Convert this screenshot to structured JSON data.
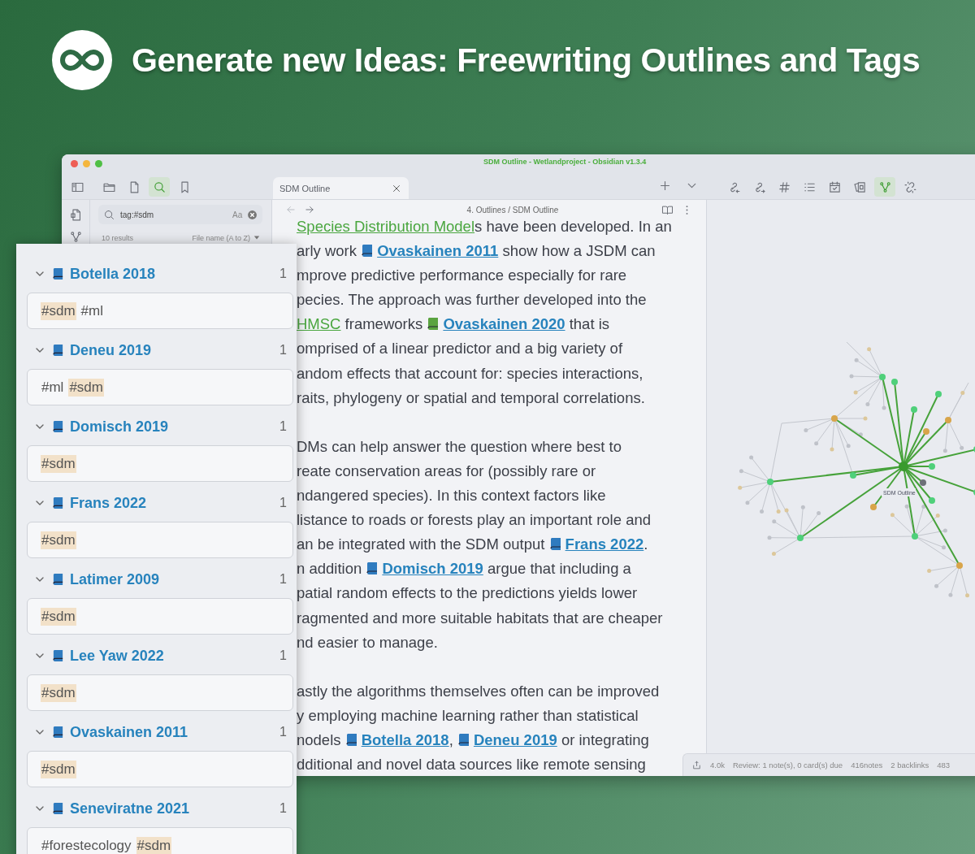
{
  "header": {
    "title": "Generate new Ideas: Freewriting Outlines and Tags"
  },
  "window": {
    "title": "SDM Outline - Wetlandproject - Obsidian v1.3.4"
  },
  "toolbar_left": [
    {
      "kind": "sidebar",
      "selected": false
    },
    {
      "kind": "folder",
      "selected": false
    },
    {
      "kind": "file",
      "selected": false
    },
    {
      "kind": "search",
      "selected": true
    },
    {
      "kind": "bookmark",
      "selected": false
    }
  ],
  "tab": {
    "label": "SDM Outline",
    "selected": true
  },
  "toolbar_right": [
    {
      "kind": "link-in",
      "selected": false
    },
    {
      "kind": "link-out",
      "selected": false
    },
    {
      "kind": "hash",
      "selected": false
    },
    {
      "kind": "list",
      "selected": false
    },
    {
      "kind": "calendar",
      "selected": false
    },
    {
      "kind": "cards",
      "selected": false
    },
    {
      "kind": "graph",
      "selected": true
    },
    {
      "kind": "unlink",
      "selected": false
    }
  ],
  "search": {
    "value": "tag:#sdm",
    "case_label": "Aa",
    "results": "10 results",
    "sort": "File name (A to Z)"
  },
  "breadcrumb": "4. Outlines / SDM Outline",
  "paragraphs": [
    {
      "lines": [
        {
          "segments": [
            {
              "kind": "wikilink",
              "text": "Species Distribution Model"
            },
            {
              "kind": "text",
              "text": "s have been developed. In an"
            }
          ]
        },
        {
          "segments": [
            {
              "kind": "text",
              "text": "arly work "
            },
            {
              "kind": "book",
              "color": "#2f7bbf"
            },
            {
              "kind": "link",
              "text": "Ovaskainen 2011"
            },
            {
              "kind": "text",
              "text": " show how a JSDM can"
            }
          ]
        },
        {
          "segments": [
            {
              "kind": "text",
              "text": "mprove predictive performance especially for rare"
            }
          ]
        },
        {
          "segments": [
            {
              "kind": "text",
              "text": "pecies. The approach was further developed into the"
            }
          ]
        },
        {
          "segments": [
            {
              "kind": "wikilink",
              "text": "HMSC"
            },
            {
              "kind": "text",
              "text": " frameworks "
            },
            {
              "kind": "book",
              "color": "#5aa33f"
            },
            {
              "kind": "link",
              "text": "Ovaskainen 2020"
            },
            {
              "kind": "text",
              "text": " that is"
            }
          ]
        },
        {
          "segments": [
            {
              "kind": "text",
              "text": "omprised of a linear predictor and a big variety of"
            }
          ]
        },
        {
          "segments": [
            {
              "kind": "text",
              "text": "andom effects that account for: species interactions,"
            }
          ]
        },
        {
          "segments": [
            {
              "kind": "text",
              "text": "raits, phylogeny or spatial and temporal correlations."
            }
          ]
        }
      ]
    },
    {
      "lines": [
        {
          "segments": [
            {
              "kind": "text",
              "text": "DMs can help answer the question where best to"
            }
          ]
        },
        {
          "segments": [
            {
              "kind": "text",
              "text": "reate conservation areas for (possibly rare or"
            }
          ]
        },
        {
          "segments": [
            {
              "kind": "text",
              "text": "ndangered species). In this context factors like"
            }
          ]
        },
        {
          "segments": [
            {
              "kind": "text",
              "text": "listance to roads or forests play an important role and"
            }
          ]
        },
        {
          "segments": [
            {
              "kind": "text",
              "text": "an be integrated with the SDM output "
            },
            {
              "kind": "book",
              "color": "#2f7bbf"
            },
            {
              "kind": "link",
              "text": "Frans 2022"
            },
            {
              "kind": "text",
              "text": "."
            }
          ]
        },
        {
          "segments": [
            {
              "kind": "text",
              "text": "n addition "
            },
            {
              "kind": "book",
              "color": "#2f7bbf"
            },
            {
              "kind": "link",
              "text": "Domisch 2019"
            },
            {
              "kind": "text",
              "text": " argue that including a"
            }
          ]
        },
        {
          "segments": [
            {
              "kind": "text",
              "text": "patial random effects to the predictions yields lower"
            }
          ]
        },
        {
          "segments": [
            {
              "kind": "text",
              "text": "ragmented and more suitable habitats that are cheaper"
            }
          ]
        },
        {
          "segments": [
            {
              "kind": "text",
              "text": "nd easier to manage."
            }
          ]
        }
      ]
    },
    {
      "lines": [
        {
          "segments": [
            {
              "kind": "text",
              "text": "astly the algorithms themselves often can be improved"
            }
          ]
        },
        {
          "segments": [
            {
              "kind": "text",
              "text": "y employing machine learning rather than statistical"
            }
          ]
        },
        {
          "segments": [
            {
              "kind": "text",
              "text": "nodels "
            },
            {
              "kind": "book",
              "color": "#2f7bbf"
            },
            {
              "kind": "link",
              "text": "Botella 2018"
            },
            {
              "kind": "text",
              "text": ", "
            },
            {
              "kind": "book",
              "color": "#2f7bbf"
            },
            {
              "kind": "link",
              "text": "Deneu 2019"
            },
            {
              "kind": "text",
              "text": " or integrating"
            }
          ]
        },
        {
          "segments": [
            {
              "kind": "text",
              "text": "dditional and novel data sources like remote sensing"
            }
          ]
        }
      ]
    }
  ],
  "graph": {
    "center_label": "SDM Outline"
  },
  "status_bar": [
    "4.0k",
    "Review: 1 note(s), 0 card(s) due",
    "416notes",
    "2 backlinks",
    "483"
  ],
  "results": [
    {
      "title": "Botella 2018",
      "count": "1",
      "expanded": true,
      "tags": [
        {
          "text": "#sdm",
          "highlighted": true
        },
        {
          "text": "#ml",
          "highlighted": false
        }
      ]
    },
    {
      "title": "Deneu 2019",
      "count": "1",
      "expanded": true,
      "tags": [
        {
          "text": "#ml",
          "highlighted": false
        },
        {
          "text": "#sdm",
          "highlighted": true
        }
      ]
    },
    {
      "title": "Domisch 2019",
      "count": "1",
      "expanded": true,
      "tags": [
        {
          "text": "#sdm",
          "highlighted": true
        }
      ]
    },
    {
      "title": "Frans 2022",
      "count": "1",
      "expanded": true,
      "tags": [
        {
          "text": "#sdm",
          "highlighted": true
        }
      ]
    },
    {
      "title": "Latimer 2009",
      "count": "1",
      "expanded": true,
      "tags": [
        {
          "text": "#sdm",
          "highlighted": true
        }
      ]
    },
    {
      "title": "Lee Yaw 2022",
      "count": "1",
      "expanded": true,
      "tags": [
        {
          "text": "#sdm",
          "highlighted": true
        }
      ]
    },
    {
      "title": "Ovaskainen 2011",
      "count": "1",
      "expanded": true,
      "tags": [
        {
          "text": "#sdm",
          "highlighted": true
        }
      ]
    },
    {
      "title": "Seneviratne 2021",
      "count": "1",
      "expanded": true,
      "tags": [
        {
          "text": "#forestecology",
          "highlighted": false
        },
        {
          "text": "#sdm",
          "highlighted": true
        }
      ]
    }
  ]
}
